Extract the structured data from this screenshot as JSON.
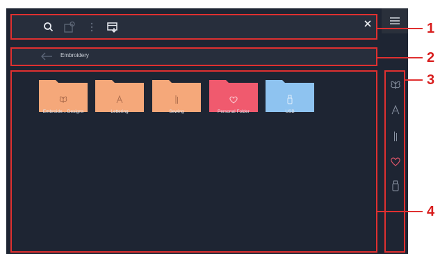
{
  "toolbar": {
    "icons": [
      "search-icon",
      "add-folder-icon",
      "more-vertical-icon",
      "save-to-card-icon",
      "close-icon"
    ]
  },
  "breadcrumb": {
    "current": "Embroidery"
  },
  "folders": [
    {
      "label": "Embroide... Designs",
      "color": "#f5a87a",
      "icon": "butterfly-icon"
    },
    {
      "label": "Lettering",
      "color": "#f5a87a",
      "icon": "letter-a-icon"
    },
    {
      "label": "Sewing",
      "color": "#f5a87a",
      "icon": "sewing-needle-icon"
    },
    {
      "label": "Personal Folder",
      "color": "#f05a6e",
      "icon": "heart-icon"
    },
    {
      "label": "USB",
      "color": "#8ec3f0",
      "icon": "usb-icon"
    }
  ],
  "sidebar": {
    "items": [
      "butterfly-icon",
      "letter-a-icon",
      "sewing-needle-icon",
      "heart-icon",
      "usb-icon"
    ]
  },
  "callouts": [
    "1",
    "2",
    "3",
    "4"
  ],
  "colors": {
    "background": "#1e2533",
    "highlight": "#e03030",
    "folder_orange": "#f5a87a",
    "folder_pink": "#f05a6e",
    "folder_blue": "#8ec3f0"
  }
}
